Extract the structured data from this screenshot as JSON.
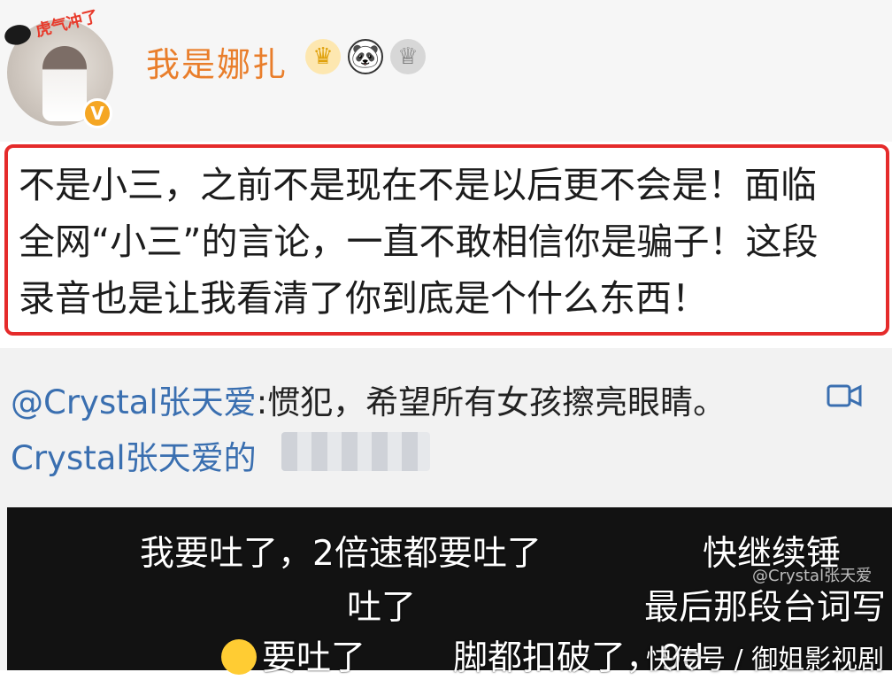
{
  "header": {
    "avatar_banner": "虎气冲了",
    "verified_badge": "V",
    "username": "我是娜扎",
    "badges": [
      {
        "icon": "crown-icon",
        "glyph": "♛"
      },
      {
        "icon": "panda-icon",
        "glyph": "🐼"
      },
      {
        "icon": "trophy-icon",
        "glyph": "♕"
      }
    ]
  },
  "post": {
    "lines": [
      "不是小三，之前不是现在不是以后更不会是！面临",
      "全网“小三”的言论，一直不敢相信你是骗子！这段",
      "录音也是让我看清了你到底是个什么东西！"
    ],
    "highlight_color": "#e52b2b"
  },
  "repost": {
    "mention": "@Crystal张天爱",
    "text": ":惯犯，希望所有女孩擦亮眼睛。",
    "video_link_prefix": "Crystal张天爱的"
  },
  "video": {
    "danmaku": [
      "我要吐了，2倍速都要吐了",
      "快继续锤",
      "吐了",
      "最后那段台词写",
      "要吐了",
      "脚都扣破了，9d"
    ],
    "watermark": "@Crystal张天爱",
    "source_credit": "快传号 / 御姐影视剧"
  }
}
